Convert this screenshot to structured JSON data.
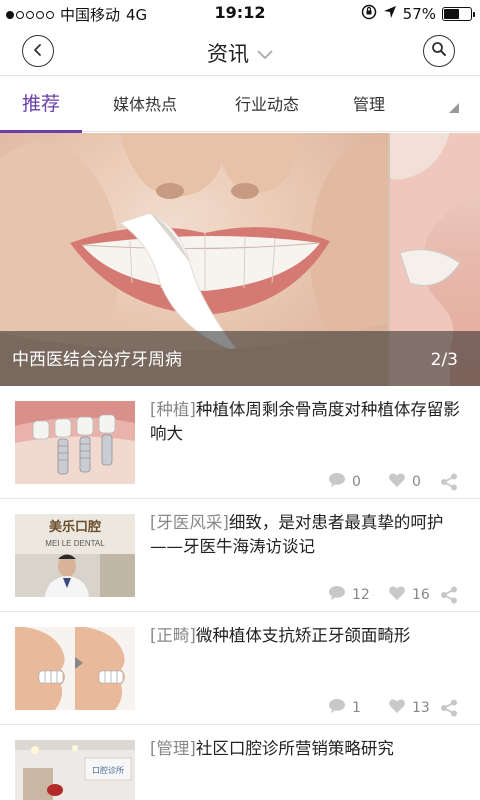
{
  "status_bar": {
    "carrier": "中国移动",
    "network": "4G",
    "time": "19:12",
    "battery": "57%",
    "battery_level": 0.57,
    "signal_dots_filled": 1
  },
  "header": {
    "title": "资讯",
    "back_icon": "chevron-left-icon",
    "search_icon": "search-icon"
  },
  "tabs": [
    {
      "label": "推荐",
      "active": true
    },
    {
      "label": "媒体热点",
      "active": false
    },
    {
      "label": "行业动态",
      "active": false
    },
    {
      "label": "管理",
      "active": false
    }
  ],
  "banner": {
    "caption": "中西医结合治疗牙周病",
    "counter": "2/3"
  },
  "news": [
    {
      "tag": "[种植]",
      "title": "种植体周剩余骨高度对种植体存留影响大",
      "comments": "0",
      "likes": "0"
    },
    {
      "tag": "[牙医风采]",
      "title": "细致，是对患者最真挚的呵护——牙医牛海涛访谈记",
      "comments": "12",
      "likes": "16"
    },
    {
      "tag": "[正畸]",
      "title": "微种植体支抗矫正牙颌面畸形",
      "comments": "1",
      "likes": "13"
    },
    {
      "tag": "[管理]",
      "title": "社区口腔诊所营销策略研究",
      "comments": "",
      "likes": ""
    }
  ],
  "thumb_texts": {
    "clinic_sign": "美乐口腔",
    "clinic_sign_en": "MEI LE DENTAL",
    "clinic_logo": "口腔诊所"
  },
  "colors": {
    "accent": "#6b3ea8",
    "meta_gray": "#888888",
    "icon_gray": "#b5b5b5"
  }
}
